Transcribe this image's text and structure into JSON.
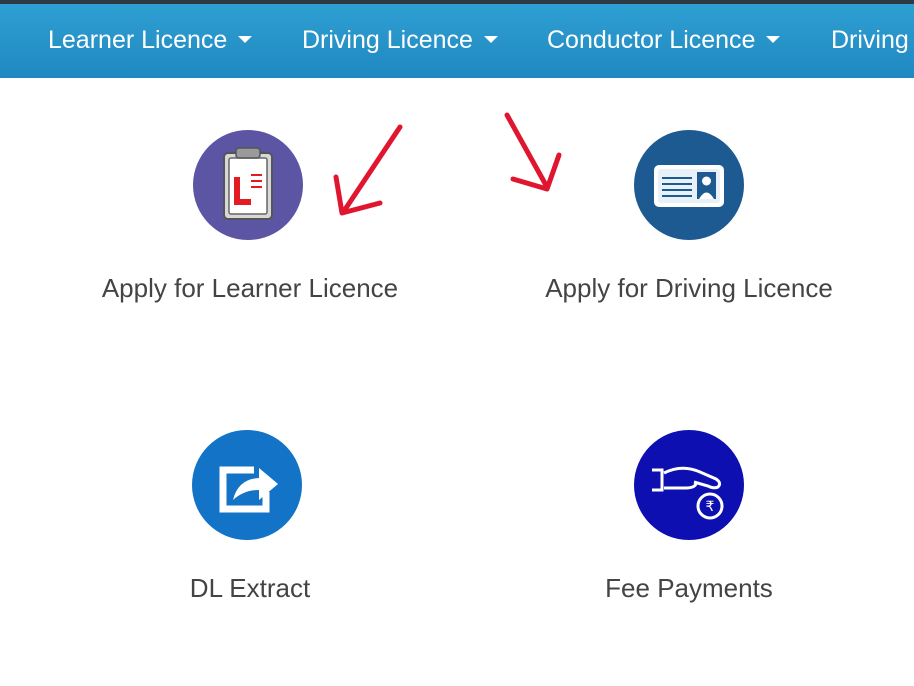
{
  "nav": {
    "items": [
      {
        "label": "Learner Licence"
      },
      {
        "label": "Driving Licence"
      },
      {
        "label": "Conductor Licence"
      },
      {
        "label": "Driving"
      }
    ]
  },
  "services": [
    {
      "label": "Apply for Learner Licence",
      "icon": "clipboard-l-icon",
      "icon_color": "#5b55a3"
    },
    {
      "label": "Apply for Driving Licence",
      "icon": "id-card-icon",
      "icon_color": "#1e5a92"
    },
    {
      "label": "DL Extract",
      "icon": "share-export-icon",
      "icon_color": "#1373c6"
    },
    {
      "label": "Fee Payments",
      "icon": "hand-rupee-icon",
      "icon_color": "#0d0fb0"
    }
  ],
  "colors": {
    "navbar": "#2694cc",
    "annotation_arrow": "#e0152f"
  }
}
